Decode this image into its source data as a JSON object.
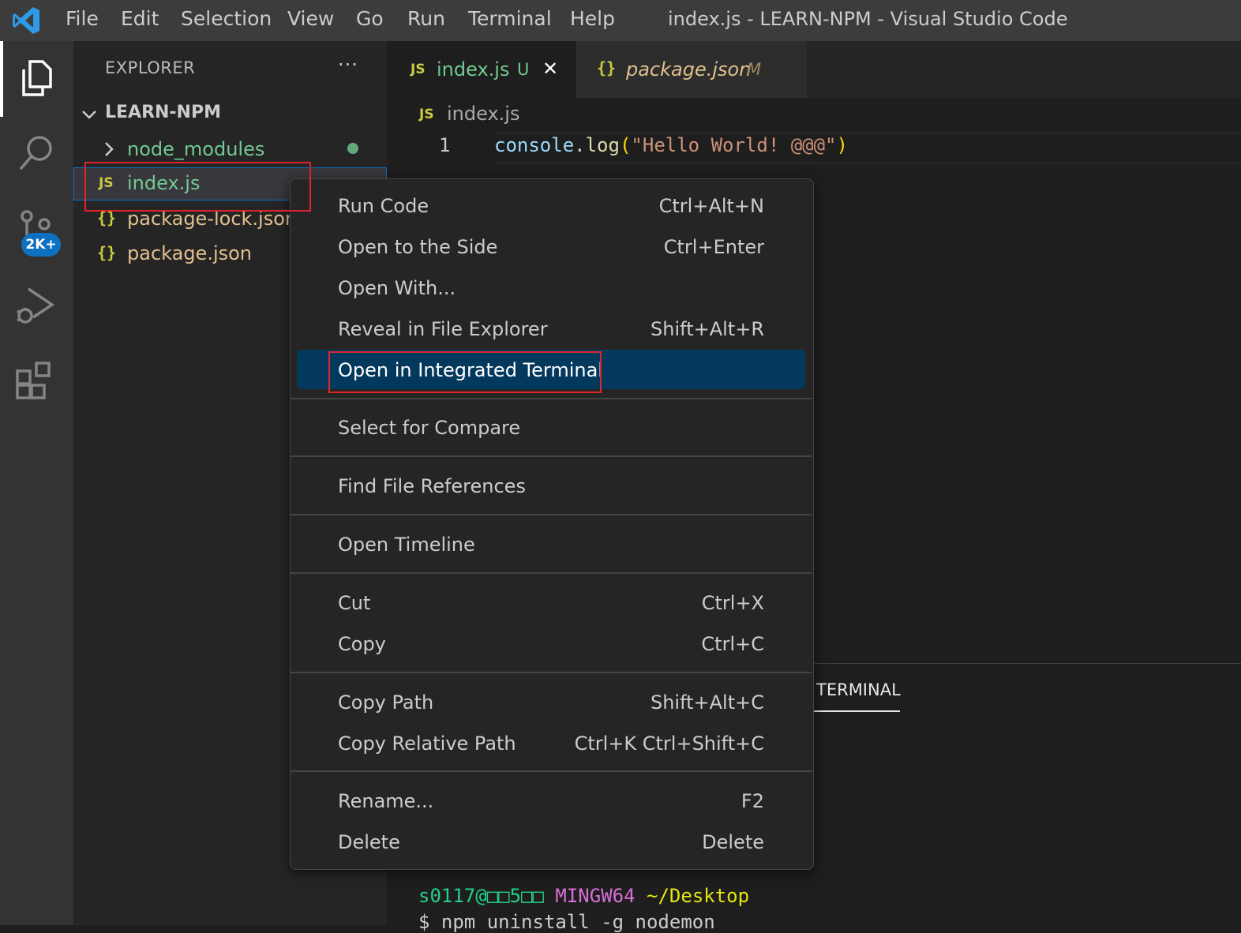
{
  "titlebar": {
    "menu": [
      "File",
      "Edit",
      "Selection",
      "View",
      "Go",
      "Run",
      "Terminal",
      "Help"
    ],
    "window_title": "index.js - LEARN-NPM - Visual Studio Code"
  },
  "activitybar": {
    "icons": [
      "explorer-icon",
      "search-icon",
      "source-control-icon",
      "run-debug-icon",
      "extensions-icon"
    ],
    "source_control_badge": "2K+"
  },
  "sidebar": {
    "title": "EXPLORER",
    "more": "···",
    "folder": "LEARN-NPM",
    "items": [
      {
        "label": "node_modules",
        "type": "folder"
      },
      {
        "label": "index.js",
        "type": "js"
      },
      {
        "label": "package-lock.json",
        "type": "json"
      },
      {
        "label": "package.json",
        "type": "json"
      }
    ]
  },
  "tabs": [
    {
      "icon": "JS",
      "label": "index.js",
      "status": "U",
      "close": "✕"
    },
    {
      "icon": "{}",
      "label": "package.json",
      "status": "M"
    }
  ],
  "editor": {
    "breadcrumb_icon": "JS",
    "breadcrumb": "index.js",
    "line_number": "1",
    "code": {
      "obj": "console",
      "dot": ".",
      "fn": "log",
      "open": "(",
      "str": "\"Hello World! @@@\"",
      "close": ")"
    }
  },
  "panel": {
    "tab": "TERMINAL",
    "lines": [
      {
        "user": "s0117@□□5□□",
        "sys": "MINGW64",
        "path": "~/Desktop"
      },
      {
        "cmd": "$ npm uninstall -g nodemon"
      }
    ]
  },
  "context_menu": {
    "items": [
      {
        "label": "Run Code",
        "key": "Ctrl+Alt+N"
      },
      {
        "label": "Open to the Side",
        "key": "Ctrl+Enter"
      },
      {
        "label": "Open With...",
        "key": ""
      },
      {
        "label": "Reveal in File Explorer",
        "key": "Shift+Alt+R"
      },
      {
        "label": "Open in Integrated Terminal",
        "key": ""
      },
      {
        "label": "Select for Compare",
        "key": ""
      },
      {
        "label": "Find File References",
        "key": ""
      },
      {
        "label": "Open Timeline",
        "key": ""
      },
      {
        "label": "Cut",
        "key": "Ctrl+X"
      },
      {
        "label": "Copy",
        "key": "Ctrl+C"
      },
      {
        "label": "Copy Path",
        "key": "Shift+Alt+C"
      },
      {
        "label": "Copy Relative Path",
        "key": "Ctrl+K Ctrl+Shift+C"
      },
      {
        "label": "Rename...",
        "key": "F2"
      },
      {
        "label": "Delete",
        "key": "Delete"
      }
    ]
  },
  "colors": {
    "accent_blue": "#0e70c0",
    "menu_highlight": "#04395e",
    "annotation_red": "#e0242d",
    "untracked_green": "#73c991",
    "modified_yellow": "#e2c08d"
  }
}
